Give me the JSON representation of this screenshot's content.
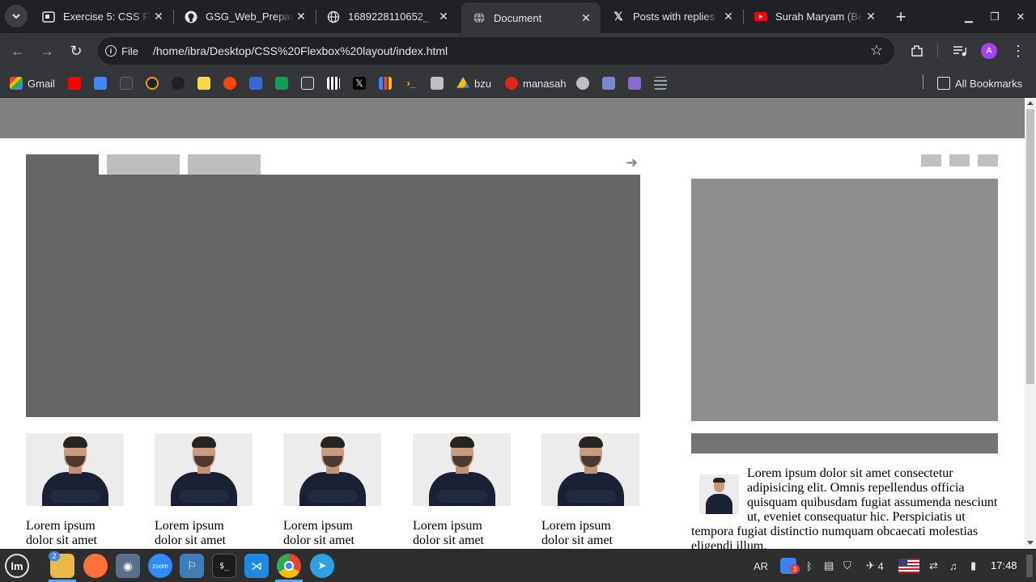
{
  "browser": {
    "tabs": [
      {
        "title": "Exercise 5: CSS Fle",
        "active": false
      },
      {
        "title": "GSG_Web_Prepara",
        "active": false
      },
      {
        "title": "1689228110652_",
        "active": false
      },
      {
        "title": "Document",
        "active": true
      },
      {
        "title": "Posts with replies",
        "active": false
      },
      {
        "title": "Surah Maryam (Be",
        "active": false
      }
    ],
    "address": {
      "scheme_label": "File",
      "url": "/home/ibra/Desktop/CSS%20Flexbox%20layout/index.html"
    },
    "avatar_initial": "A",
    "bookmarks": [
      "Gmail",
      "bzu",
      "manasah"
    ],
    "all_bookmarks_label": "All Bookmarks"
  },
  "page": {
    "cards": [
      {
        "caption": "Lorem ipsum dolor sit amet"
      },
      {
        "caption": "Lorem ipsum dolor sit amet"
      },
      {
        "caption": "Lorem ipsum dolor sit amet"
      },
      {
        "caption": "Lorem ipsum dolor sit amet"
      },
      {
        "caption": "Lorem ipsum dolor sit amet"
      }
    ],
    "side_paragraph": "Lorem ipsum dolor sit amet consectetur adipisicing elit. Omnis repellendus officia quisquam quibusdam fugiat assumenda nesciunt ut, eveniet consequatur hic. Perspiciatis ut tempora fugiat distinctio numquam obcaecati molestias eligendi illum."
  },
  "taskbar": {
    "files_badge": "2",
    "zoom_label": "zoom",
    "keyboard_layout": "AR",
    "notification_count": "3",
    "workspace_number": "4",
    "clock": "17:48"
  },
  "colors": {
    "header": "#808080",
    "slider": "#666666",
    "tab_active": "#666666",
    "tab_inactive": "#bdbdbd",
    "side_image": "#8e8e8e",
    "side_bar": "#737373"
  }
}
